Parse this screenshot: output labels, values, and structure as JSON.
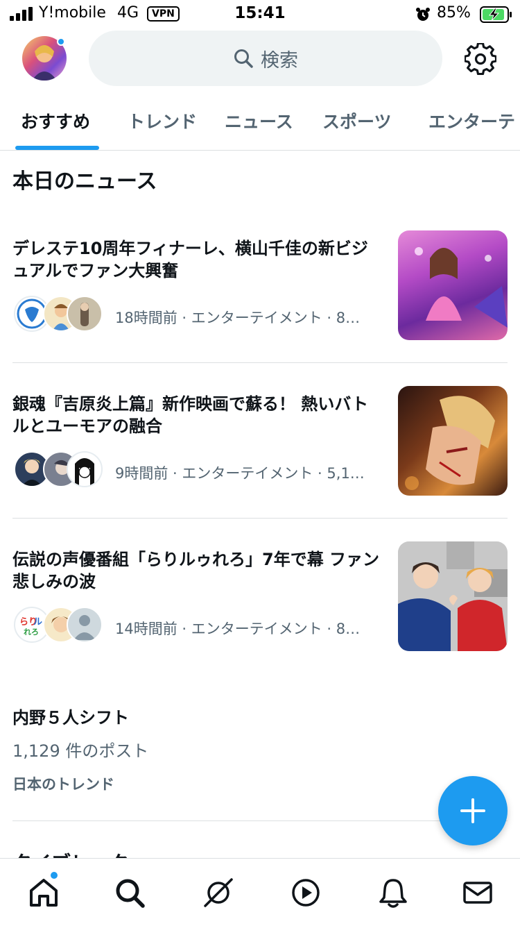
{
  "status_bar": {
    "carrier": "Y!mobile",
    "network": "4G",
    "vpn": "VPN",
    "time": "15:41",
    "battery": "85%"
  },
  "header": {
    "search_placeholder": "検索"
  },
  "tabs": [
    {
      "label": "おすすめ",
      "active": true
    },
    {
      "label": "トレンド",
      "active": false
    },
    {
      "label": "ニュース",
      "active": false
    },
    {
      "label": "スポーツ",
      "active": false
    },
    {
      "label": "エンターテ",
      "active": false
    }
  ],
  "section_title": "本日のニュース",
  "news": [
    {
      "title": "デレステ10周年フィナーレ、横山千佳の新ビジュアルでファン大興奮",
      "meta": "18時間前 · エンターテイメント · 8…"
    },
    {
      "title": "銀魂『吉原炎上篇』新作映画で蘇る！ 熱いバトルとユーモアの融合",
      "meta": "9時間前 · エンターテイメント · 5,1…"
    },
    {
      "title": "伝説の声優番組「らりルゥれろ」7年で幕 ファン悲しみの波",
      "meta": "14時間前 · エンターテイメント · 8…"
    }
  ],
  "trend": {
    "name": "内野５人シフト",
    "count": "1,129 件のポスト",
    "region": "日本のトレンド"
  },
  "cut_off_text": "タイブレーク",
  "colors": {
    "accent": "#1d9bf0",
    "secondary_text": "#536471",
    "divider": "#dcdfe1"
  }
}
